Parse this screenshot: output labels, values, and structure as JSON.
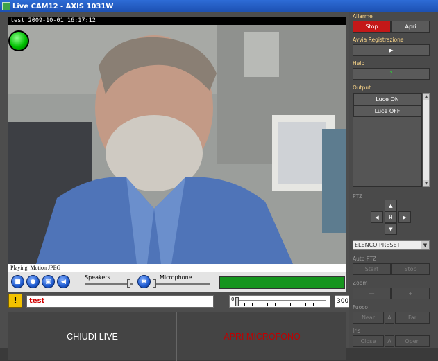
{
  "window": {
    "title": "Live CAM12 - AXIS 1031W"
  },
  "video": {
    "timestamp": "test 2009-10-01 16:17:12"
  },
  "player": {
    "status": "Playing, Motion JPEG",
    "speakers_label": "Speakers",
    "microphone_label": "Microphone"
  },
  "alert": {
    "text": "test"
  },
  "ruler": {
    "min": "0",
    "value": "300"
  },
  "buttons": {
    "close_live": "CHIUDI LIVE",
    "open_mic": "APRI MICROFONO"
  },
  "sidebar": {
    "alarm_label": "Allarme",
    "alarm_stop": "Stop",
    "alarm_open": "Apri",
    "record_label": "Avvia Registrazione",
    "record_play": "▶",
    "help_label": "Help",
    "help_icon": "?",
    "output_label": "Output",
    "outputs": [
      "Luce ON",
      "Luce OFF"
    ],
    "ptz_label": "PTZ",
    "ptz_home": "H",
    "preset_value": "ELENCO PRESET",
    "auto_ptz_label": "Auto PTZ",
    "auto_start": "Start",
    "auto_stop": "Stop",
    "zoom_label": "Zoom",
    "zoom_out": "—",
    "zoom_in": "+",
    "focus_label": "Fuoco",
    "focus_near": "Near",
    "focus_auto": "A",
    "focus_far": "Far",
    "iris_label": "Iris",
    "iris_close": "Close",
    "iris_auto": "A",
    "iris_open": "Open"
  },
  "colors": {
    "alarm_active": "#c41818",
    "level_green": "#16951e",
    "mic_text": "#c00000",
    "label_yellow": "#ffd98a"
  }
}
